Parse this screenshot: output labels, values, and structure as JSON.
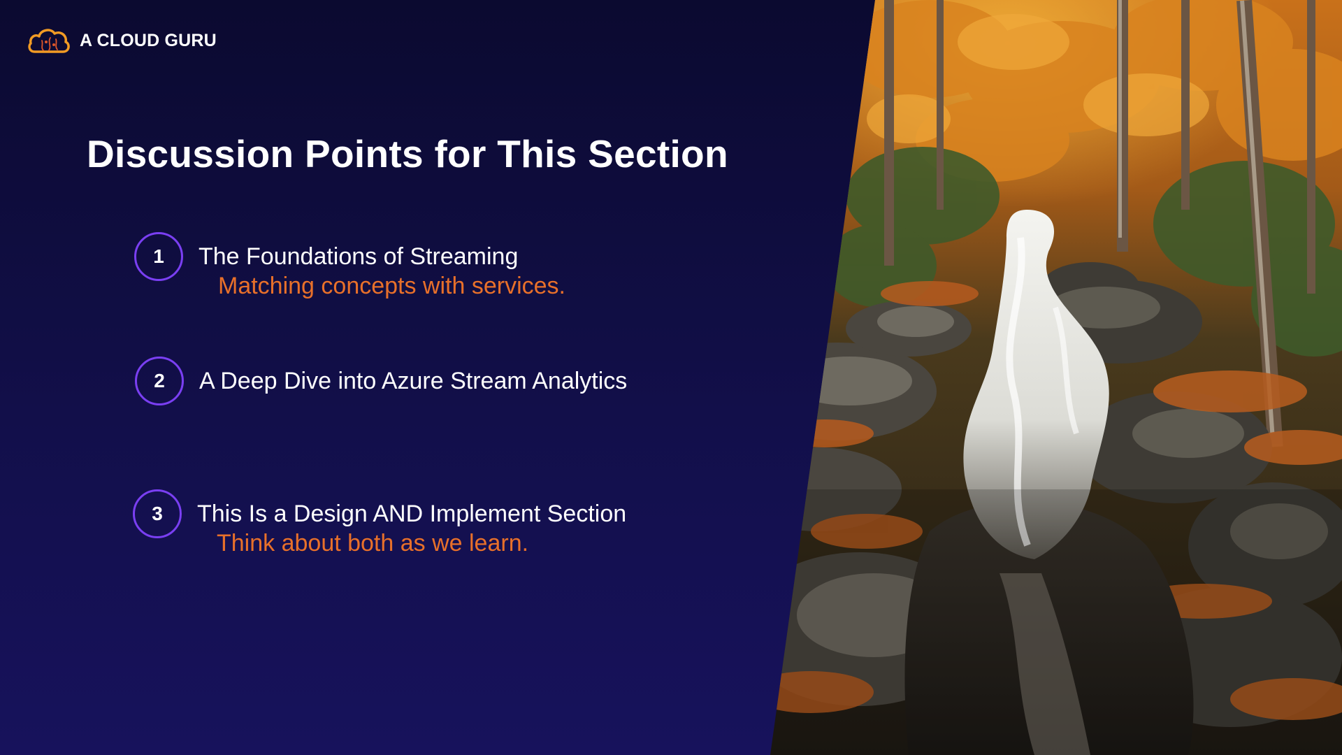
{
  "brand": {
    "name": "A CLOUD GURU",
    "icon": "cloud-logo-icon",
    "accent": "#f29b24"
  },
  "slide": {
    "title": "Discussion Points for This Section",
    "points": [
      {
        "number": "1",
        "text": "The Foundations of Streaming",
        "subtext": "Matching concepts with services."
      },
      {
        "number": "2",
        "text": "A Deep Dive into Azure Stream Analytics",
        "subtext": ""
      },
      {
        "number": "3",
        "text": "This Is a Design AND Implement Section",
        "subtext": "Think about both as we learn."
      }
    ]
  },
  "colors": {
    "background": "#120f4a",
    "circle_border": "#7a3ff2",
    "subtext": "#e8702a",
    "text": "#ffffff"
  },
  "image": {
    "subject": "autumn-forest-waterfall-photo"
  }
}
